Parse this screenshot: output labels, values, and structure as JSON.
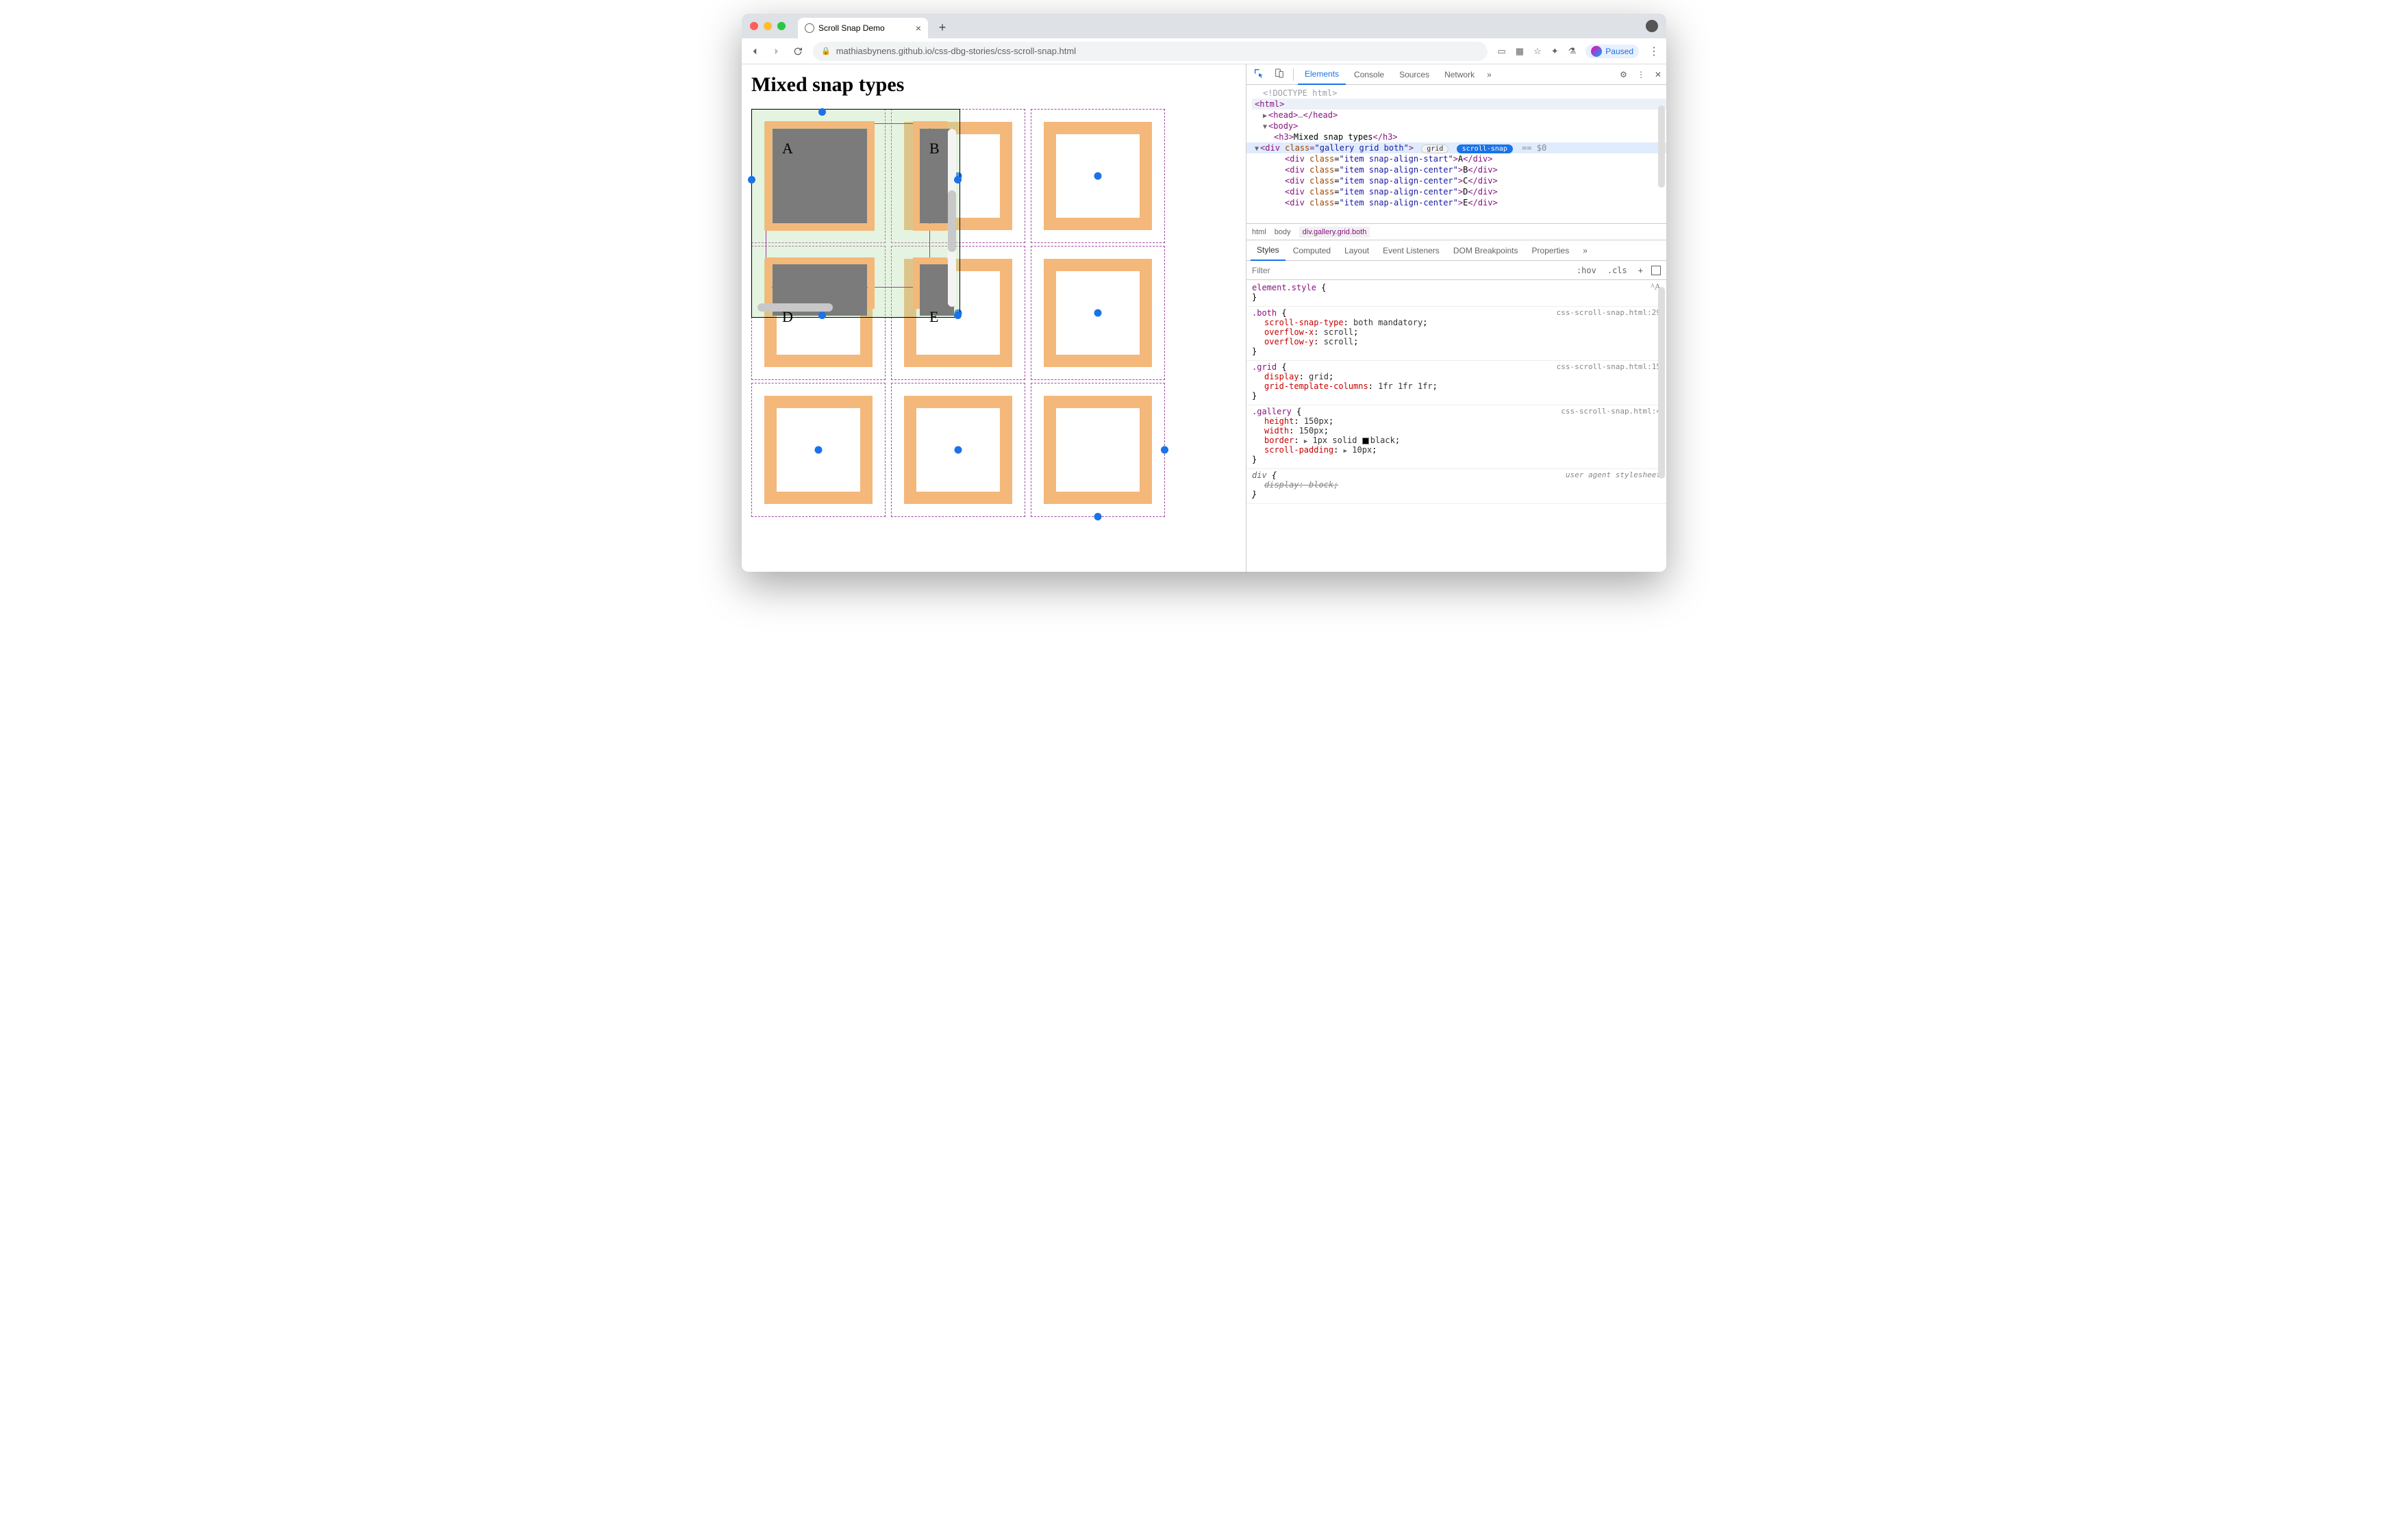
{
  "browser": {
    "tab_title": "Scroll Snap Demo",
    "url_display": "mathiasbynens.github.io/css-dbg-stories/css-scroll-snap.html",
    "paused_label": "Paused"
  },
  "page": {
    "heading": "Mixed snap types",
    "cells": {
      "a": "A",
      "b": "B",
      "d": "D",
      "e": "E"
    }
  },
  "devtools": {
    "tabs": {
      "elements": "Elements",
      "console": "Console",
      "sources": "Sources",
      "network": "Network"
    },
    "dom": {
      "doctype": "<!DOCTYPE html>",
      "html_open": "html",
      "head_open": "head",
      "head_ell": "…",
      "body_open": "body",
      "h3": "h3",
      "h3_text": "Mixed snap types",
      "gallery_class": "gallery grid both",
      "badge_grid": "grid",
      "badge_snap": "scroll-snap",
      "eq": "== $0",
      "items": [
        {
          "cls": "item snap-align-start",
          "t": "A"
        },
        {
          "cls": "item snap-align-center",
          "t": "B"
        },
        {
          "cls": "item snap-align-center",
          "t": "C"
        },
        {
          "cls": "item snap-align-center",
          "t": "D"
        },
        {
          "cls": "item snap-align-center",
          "t": "E"
        }
      ]
    },
    "breadcrumb": {
      "html": "html",
      "body": "body",
      "sel": "div.gallery.grid.both"
    },
    "styles_tabs": {
      "styles": "Styles",
      "computed": "Computed",
      "layout": "Layout",
      "listeners": "Event Listeners",
      "dombp": "DOM Breakpoints",
      "props": "Properties"
    },
    "filter_placeholder": "Filter",
    "filter_ctl": {
      "hov": ":hov",
      "cls": ".cls",
      "plus": "+"
    },
    "rules": {
      "element_style": "element.style",
      "both": {
        "sel": ".both",
        "src": "css-scroll-snap.html:29",
        "p1n": "scroll-snap-type",
        "p1v": "both mandatory",
        "p2n": "overflow-x",
        "p2v": "scroll",
        "p3n": "overflow-y",
        "p3v": "scroll"
      },
      "grid": {
        "sel": ".grid",
        "src": "css-scroll-snap.html:15",
        "p1n": "display",
        "p1v": "grid",
        "p2n": "grid-template-columns",
        "p2v": "1fr 1fr 1fr"
      },
      "gallery": {
        "sel": ".gallery",
        "src": "css-scroll-snap.html:4",
        "p1n": "height",
        "p1v": "150px",
        "p2n": "width",
        "p2v": "150px",
        "p3n": "border",
        "p3v": "1px solid",
        "p3c": "black",
        "p4n": "scroll-padding",
        "p4v": "10px"
      },
      "ua": {
        "sel": "div",
        "src": "user agent stylesheet",
        "p1n": "display",
        "p1v": "block"
      }
    }
  }
}
